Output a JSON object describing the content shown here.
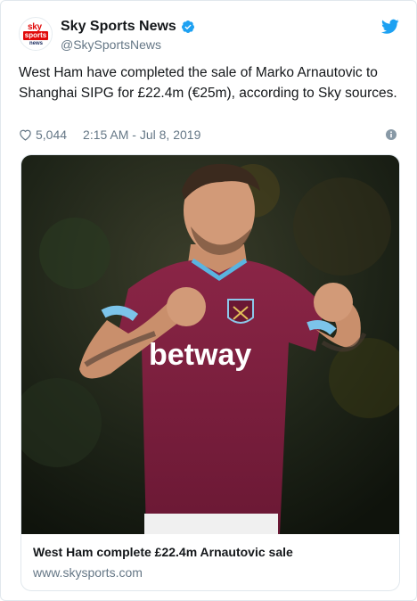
{
  "account": {
    "display_name": "Sky Sports News",
    "handle": "@SkySportsNews",
    "avatar_logo": {
      "line1": "sky",
      "line2": "sports",
      "line3": "news"
    }
  },
  "tweet": {
    "text": "West Ham have completed the sale of Marko Arnautovic to Shanghai SIPG for £22.4m (€25m), according to Sky sources.",
    "likes": "5,044",
    "timestamp": "2:15 AM - Jul 8, 2019"
  },
  "link_card": {
    "jersey_sponsor": "betway",
    "title": "West Ham complete £22.4m Arnautovic sale",
    "domain": "www.skysports.com"
  },
  "colors": {
    "twitter_blue": "#1da1f2",
    "verified_blue": "#1da1f2",
    "sky_red": "#e10a0a",
    "jersey_claret": "#7a1f3d",
    "muted_text": "#657786"
  },
  "icons": {
    "verified": "verified-badge-icon",
    "brand": "twitter-bird-icon",
    "like": "heart-icon",
    "info": "info-icon"
  }
}
